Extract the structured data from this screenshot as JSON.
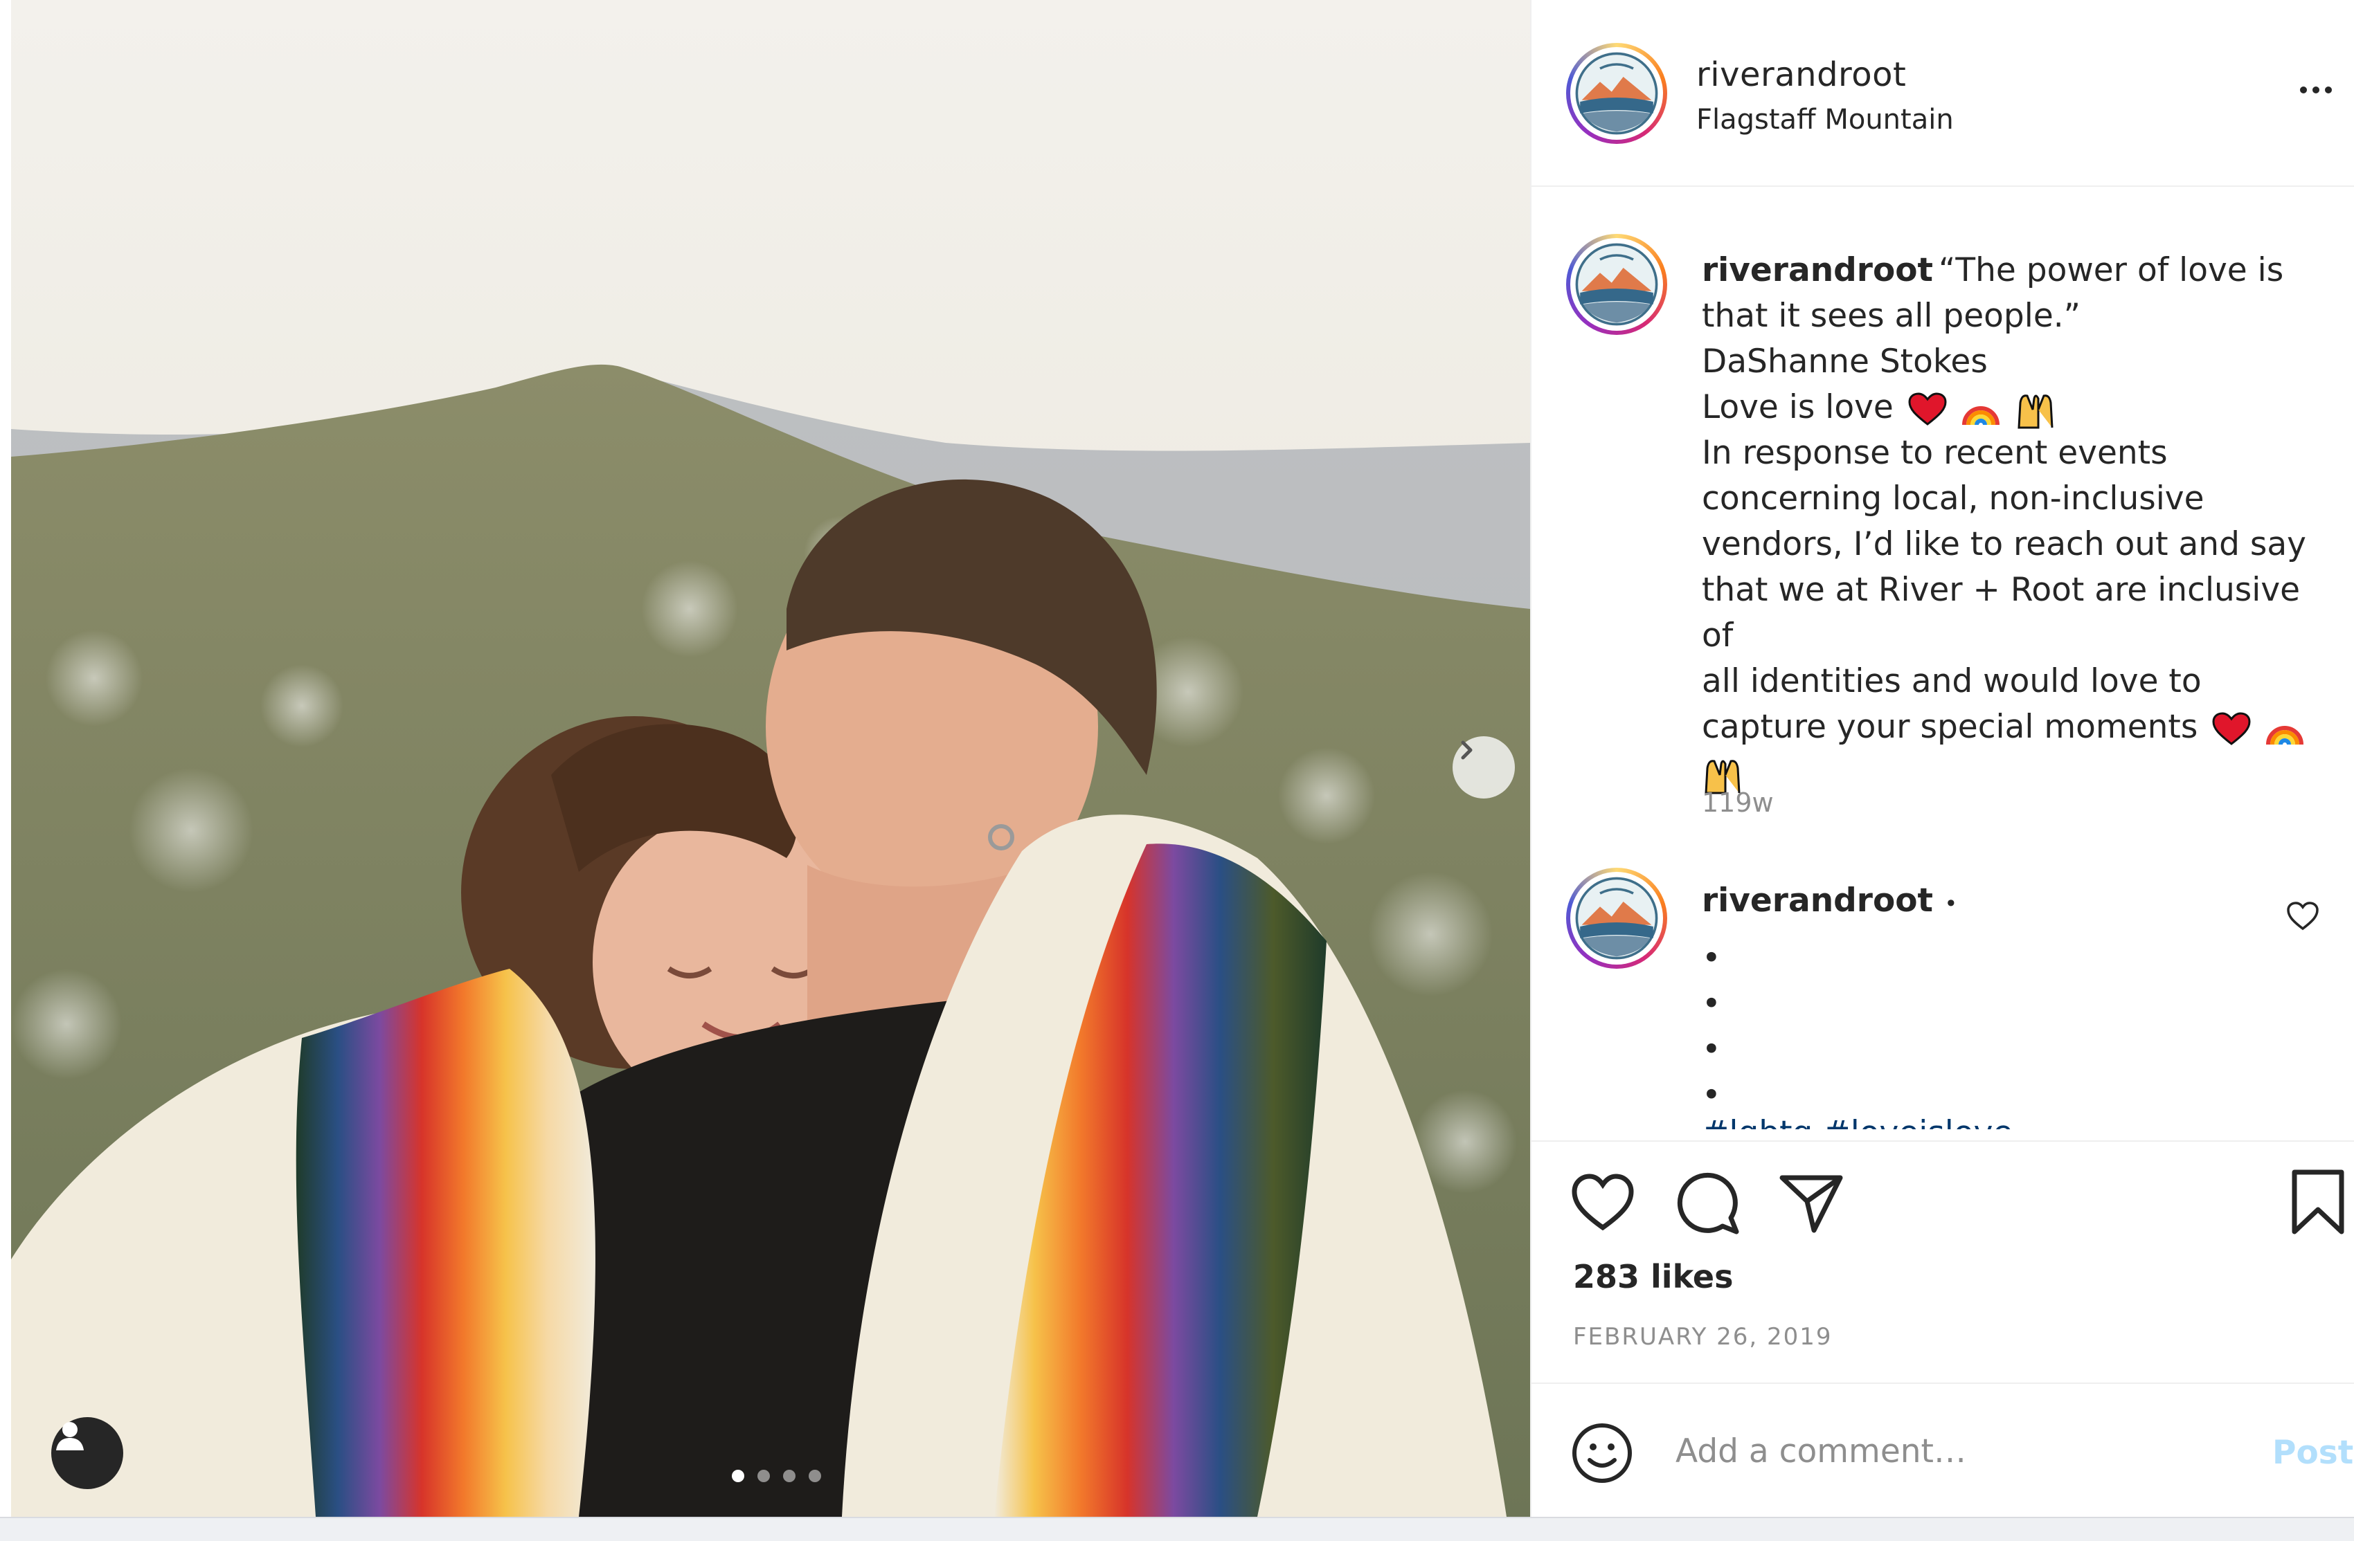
{
  "post": {
    "username": "riverandroot",
    "location": "Flagstaff Mountain",
    "caption_lines": [
      "“The power of love is",
      "that it sees all people.”",
      "DaShanne Stokes",
      "Love is love",
      "In response to recent events",
      "concerning local, non-inclusive",
      "vendors, I’d like to reach out and say",
      "that we at River + Root are inclusive of",
      "all identities and would love to",
      "capture your special moments"
    ],
    "caption_emojis": [
      "red-heart",
      "rainbow",
      "raising-hands"
    ],
    "timestamp": "119w",
    "reply": {
      "username": "riverandroot",
      "separator": "•",
      "bullets": [
        "•",
        "•",
        "•",
        "•"
      ],
      "hashtags_partial": "#lgbtq #loveislove"
    },
    "likes": "283 likes",
    "date": "FEBRUARY 26, 2019",
    "comment_placeholder": "Add a comment…",
    "post_button": "Post",
    "carousel": {
      "total": 4,
      "current": 1
    }
  },
  "colors": {
    "text": "#262626",
    "muted": "#8e8e8e",
    "post_button_disabled": "#b2dffc",
    "hashtag": "#00376b",
    "border": "#efefef"
  },
  "icons": [
    "more-options-icon",
    "like-icon",
    "comment-icon",
    "share-icon",
    "save-icon",
    "emoji-icon",
    "chevron-right-icon",
    "user-tag-icon"
  ]
}
